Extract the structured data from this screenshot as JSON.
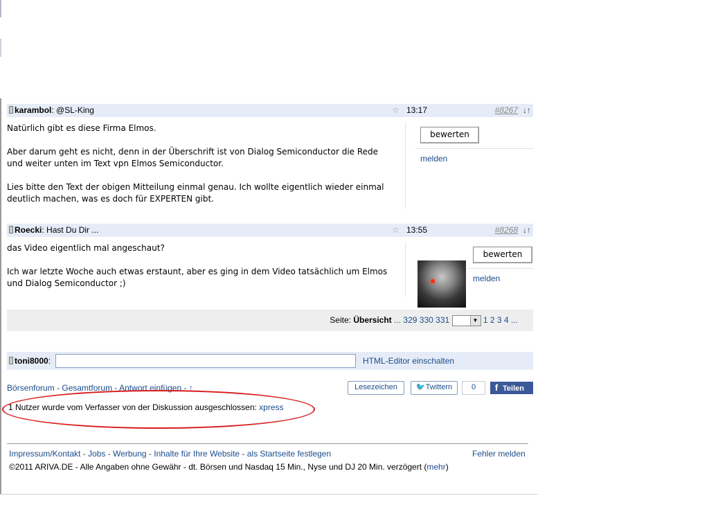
{
  "posts": [
    {
      "author": "karambol",
      "subject": "@SL-King",
      "time": "13:17",
      "number": "#8267",
      "arrows": "↓↑",
      "star": "☆",
      "paragraphs": [
        "Natürlich gibt es diese Firma Elmos.",
        "Aber darum geht es nicht,  denn in der Überschrift  ist von Dialog Semiconductor die Rede  und weiter unten im Text  vpn Elmos Semiconductor.",
        "Lies bitte den Text  der obigen Mitteilung  einmal genau.  Ich wollte eigentlich wieder einmal deutlich machen,  was es doch für EXPERTEN  gibt."
      ],
      "rate_label": "bewerten",
      "report_label": "melden"
    },
    {
      "author": "Roecki",
      "subject": "Hast Du Dir ...",
      "time": "13:55",
      "number": "#8268",
      "arrows": "↓↑",
      "star": "☆",
      "paragraphs": [
        "das Video eigentlich mal angeschaut?",
        "Ich war letzte Woche auch etwas erstaunt, aber es ging in dem Video tatsächlich um Elmos und Dialog Semiconductor ;)"
      ],
      "rate_label": "bewerten",
      "report_label": "melden"
    }
  ],
  "pager": {
    "label": "Seite:",
    "overview": "Übersicht",
    "ellipsis1": "...",
    "pages_before": [
      "329",
      "330",
      "331"
    ],
    "pages_after": [
      "1",
      "2",
      "3",
      "4"
    ],
    "ellipsis2": "..."
  },
  "reply": {
    "user": "toni8000",
    "colon": ":",
    "input_value": "",
    "editor_link": "HTML-Editor einschalten"
  },
  "nav": {
    "forum": "Börsenforum",
    "sep1": " - ",
    "overall": "Gesamtforum",
    "sep2": " - ",
    "reply": "Antwort einfügen",
    "sep3": " - ",
    "up": "↑"
  },
  "social": {
    "bookmark": "Lesezeichen",
    "twitter": "Twittern",
    "count": "0",
    "facebook": "Teilen"
  },
  "exclusion": {
    "text": "1 Nutzer wurde vom Verfasser von der Diskussion ausgeschlossen: ",
    "user": "xpress"
  },
  "footer": {
    "links": [
      "Impressum/Kontakt",
      "Jobs",
      "Werbung",
      "Inhalte für Ihre Website",
      "als Startseite festlegen"
    ],
    "sep": " - ",
    "report_error": "Fehler melden",
    "copyright": "©2011 ARIVA.DE - Alle Angaben ohne Gewähr - dt. Börsen und Nasdaq 15 Min., Nyse und DJ 20 Min. verzögert (",
    "more": "mehr",
    "close_paren": ")"
  },
  "colors": {
    "header_bg": "#e6ecf7",
    "link": "#1a4c8a",
    "highlight_oval": "#d81c1c",
    "facebook": "#3b5998"
  }
}
